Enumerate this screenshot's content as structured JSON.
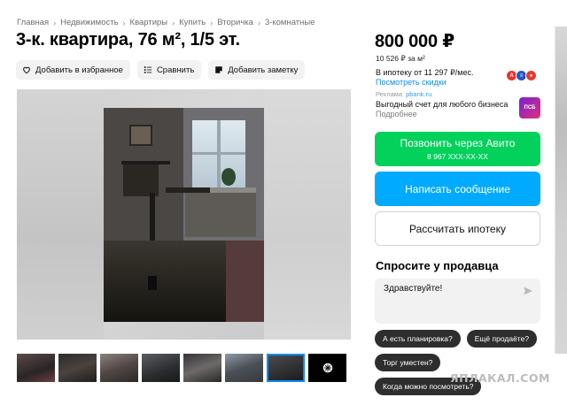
{
  "breadcrumb": [
    "Главная",
    "Недвижимость",
    "Квартиры",
    "Купить",
    "Вторичка",
    "3-комнатные"
  ],
  "listing": {
    "title": "3-к. квартира, 76 м², 1/5 эт."
  },
  "actions": {
    "favorite": "Добавить в избранное",
    "compare": "Сравнить",
    "note": "Добавить заметку"
  },
  "price": {
    "value": "800 000 ₽",
    "per_m2": "10 526 ₽ за м²",
    "mortgage": "В ипотеку от 11 297 ₽/мес.",
    "discount_link": "Посмотреть скидки"
  },
  "ad": {
    "label": "Реклама",
    "site": "pbank.ru",
    "text": "Выгодный счет для любого бизнеса",
    "more": "Подробнее",
    "logo_text": "ПСБ"
  },
  "buttons": {
    "call": "Позвонить через Авито",
    "phone": "8 967 XXX-XX-XX",
    "message": "Написать сообщение",
    "mortgage": "Рассчитать ипотеку"
  },
  "ask": {
    "title": "Спросите у продавца",
    "input_value": "Здравствуйте!",
    "quick_questions": [
      "А есть планировка?",
      "Ещё продаёте?",
      "Торг уместен?",
      "Когда можно посмотреть?"
    ]
  },
  "watermark": "ЯПЛАКАЛ.COM",
  "colors": {
    "call_button": "#02d15c",
    "message_button": "#00aaff",
    "link": "#0a8cf0",
    "chip": "#2e2e2e"
  }
}
